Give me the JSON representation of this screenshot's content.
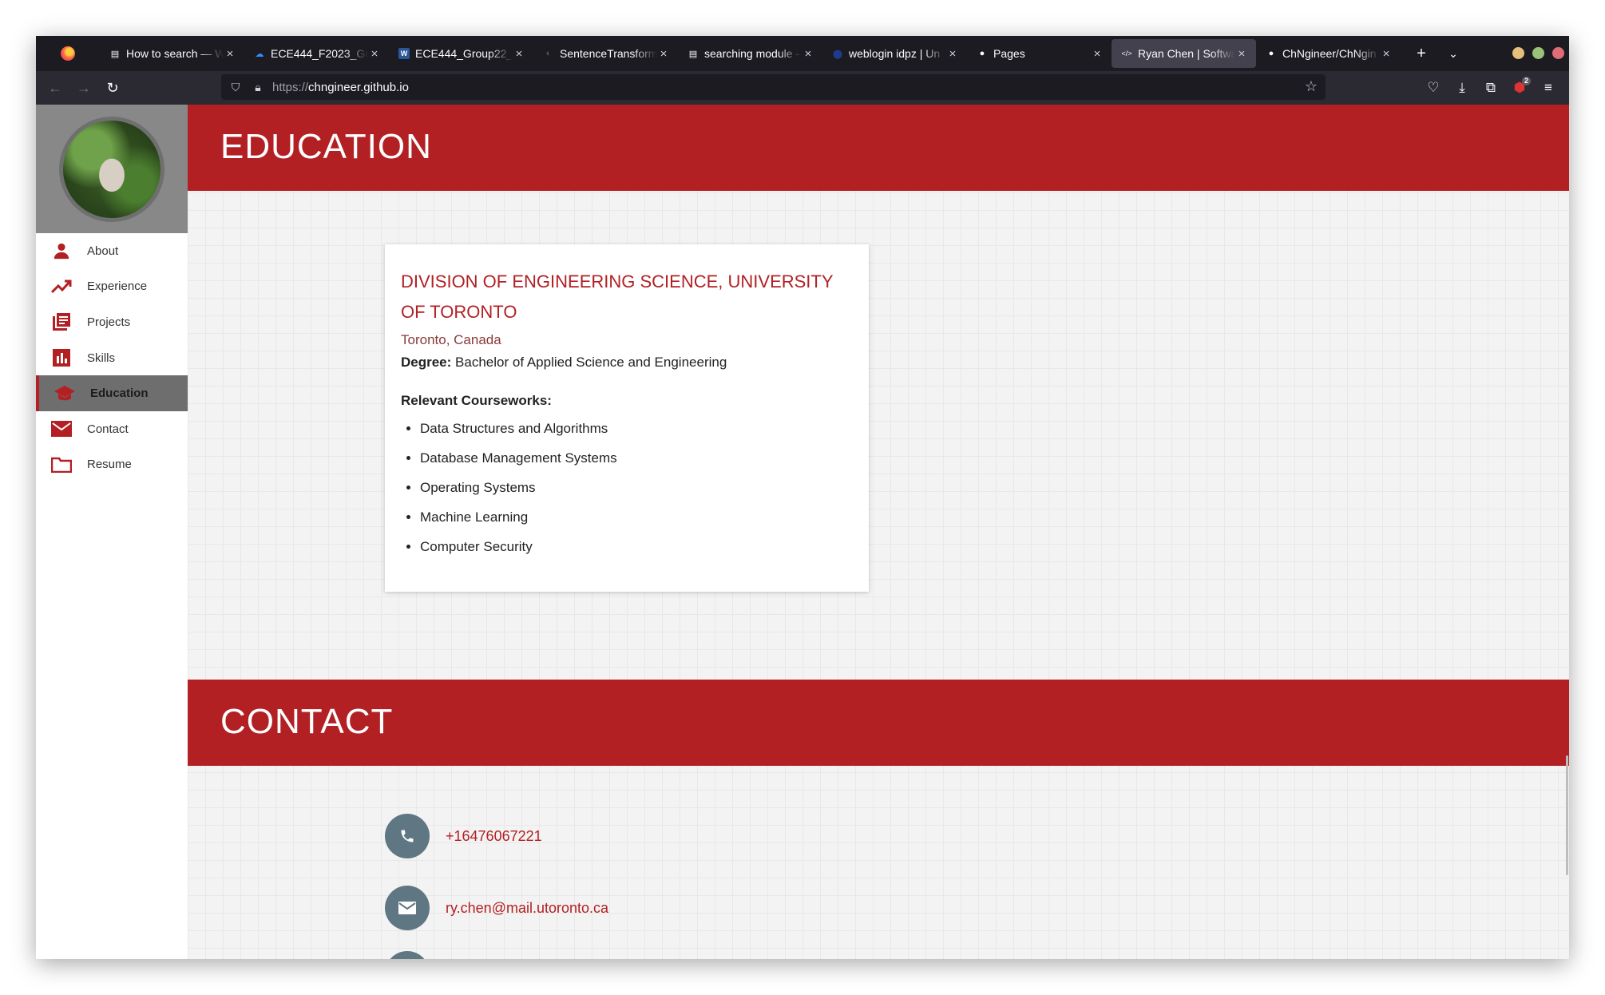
{
  "browser": {
    "tabs": [
      {
        "title": "How to search — W",
        "favicon": "doc-icon",
        "active": false
      },
      {
        "title": "ECE444_F2023_Gro",
        "favicon": "onedrive-icon",
        "active": false
      },
      {
        "title": "ECE444_Group22_M",
        "favicon": "word-icon",
        "active": false
      },
      {
        "title": "SentenceTransform",
        "favicon": "sbert-icon",
        "active": false
      },
      {
        "title": "searching module -",
        "favicon": "doc-icon",
        "active": false
      },
      {
        "title": "weblogin idpz | Un",
        "favicon": "uoft-icon",
        "active": false
      },
      {
        "title": "Pages",
        "favicon": "github-icon",
        "active": false
      },
      {
        "title": "Ryan Chen | Softwa",
        "favicon": "code-icon",
        "active": true
      },
      {
        "title": "ChNgineer/ChNgin",
        "favicon": "github-icon",
        "active": false
      }
    ],
    "url_scheme": "https://",
    "url_host": "chngineer.github.io",
    "extension_badge": "2",
    "window_colors": {
      "min": "#e5c07b",
      "max": "#98c379",
      "close": "#e06c75"
    }
  },
  "sidebar": {
    "items": [
      {
        "label": "About",
        "icon": "person-icon"
      },
      {
        "label": "Experience",
        "icon": "trending-up-icon"
      },
      {
        "label": "Projects",
        "icon": "library-books-icon"
      },
      {
        "label": "Skills",
        "icon": "bar-chart-icon"
      },
      {
        "label": "Education",
        "icon": "graduation-cap-icon",
        "active": true
      },
      {
        "label": "Contact",
        "icon": "mail-icon"
      },
      {
        "label": "Resume",
        "icon": "folder-icon"
      }
    ]
  },
  "education": {
    "heading": "EDUCATION",
    "school": "Division of Engineering Science, University of Toronto",
    "location": "Toronto, Canada",
    "degree_label": "Degree:",
    "degree": "Bachelor of Applied Science and Engineering",
    "courseworks_title": "Relevant Courseworks:",
    "courses": [
      "Data Structures and Algorithms",
      "Database Management Systems",
      "Operating Systems",
      "Machine Learning",
      "Computer Security"
    ]
  },
  "contact": {
    "heading": "CONTACT",
    "phone": "+16476067221",
    "email": "ry.chen@mail.utoronto.ca"
  },
  "colors": {
    "accent": "#b22024",
    "sidebar_header": "#888888",
    "contact_circle": "#5f7683"
  }
}
